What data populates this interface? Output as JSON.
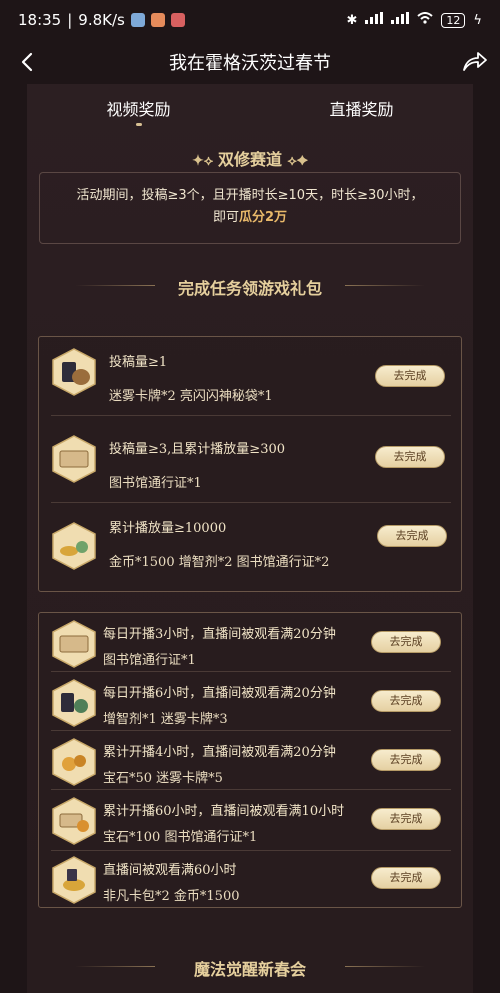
{
  "status_bar": {
    "time": "18:35",
    "speed": "9.8K/s",
    "battery": "12"
  },
  "nav": {
    "title": "我在霍格沃茨过春节"
  },
  "tabs": [
    {
      "label": "视频奖励",
      "active": true
    },
    {
      "label": "直播奖励",
      "active": false
    }
  ],
  "track": {
    "title": "双修赛道",
    "desc_line1": "活动期间，投稿≥3个，且开播时长≥10天，时长≥30小时，",
    "desc_line2_prefix": "即可",
    "desc_line2_highlight": "瓜分2万"
  },
  "tasks_section": {
    "title": "完成任务领游戏礼包"
  },
  "video_tasks": [
    {
      "task": "投稿量≥1",
      "reward": "迷雾卡牌*2  亮闪闪神秘袋*1",
      "button": "去完成",
      "icon": "card-bag-icon"
    },
    {
      "task": "投稿量≥3,且累计播放量≥300",
      "reward": "图书馆通行证*1",
      "button": "去完成",
      "icon": "ticket-icon"
    },
    {
      "task": "累计播放量≥10000",
      "reward": "金币*1500  增智剂*2  图书馆通行证*2",
      "button": "去完成",
      "icon": "coins-potion-icon"
    }
  ],
  "live_tasks": [
    {
      "task": "每日开播3小时，直播间被观看满20分钟",
      "reward": "图书馆通行证*1",
      "button": "去完成",
      "icon": "ticket-icon"
    },
    {
      "task": "每日开播6小时，直播间被观看满20分钟",
      "reward": "增智剂*1  迷雾卡牌*3",
      "button": "去完成",
      "icon": "potion-card-icon"
    },
    {
      "task": "累计开播4小时，直播间被观看满20分钟",
      "reward": "宝石*50  迷雾卡牌*5",
      "button": "去完成",
      "icon": "gems-icon"
    },
    {
      "task": "累计开播60小时，直播间被观看满10小时",
      "reward": "宝石*100  图书馆通行证*1",
      "button": "去完成",
      "icon": "gems-ticket-icon"
    },
    {
      "task": "直播间被观看满60小时",
      "reward": "非凡卡包*2    金币*1500",
      "button": "去完成",
      "icon": "card-coins-icon"
    }
  ],
  "footer_section": {
    "title": "魔法觉醒新春会"
  },
  "colors": {
    "background": "#1e1517",
    "gold_text": "#e5cf9d",
    "highlight": "#e9b96a",
    "button": "#f1e2bb"
  }
}
